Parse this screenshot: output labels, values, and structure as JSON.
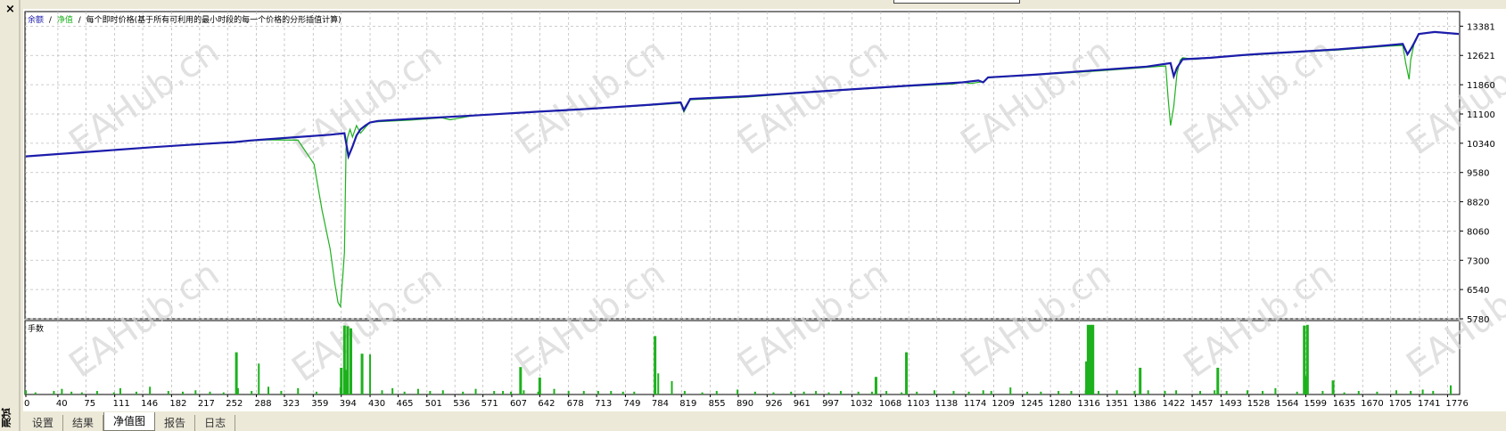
{
  "window": {
    "side_label": "测试",
    "close_glyph": "×"
  },
  "tabs": [
    {
      "label": "设置",
      "active": false
    },
    {
      "label": "结果",
      "active": false
    },
    {
      "label": "净值图",
      "active": true
    },
    {
      "label": "报告",
      "active": false
    },
    {
      "label": "日志",
      "active": false
    }
  ],
  "colors": {
    "balance": "#1c1cab",
    "equity": "#1db11d",
    "lots": "#1db11d",
    "grid": "#bdbdbd",
    "background": "#ffffff",
    "watermark": "#d4d4d4"
  },
  "watermark": "EAHub.cn",
  "chart_data": [
    {
      "type": "line",
      "legend": {
        "balance": "余额",
        "separator": "/",
        "equity": "净值",
        "description": "每个即时价格(基于所有可利用的最小时段的每一个价格的分形插值计算)"
      },
      "x_ticks": [
        0,
        40,
        75,
        111,
        146,
        182,
        217,
        252,
        288,
        323,
        359,
        394,
        430,
        465,
        501,
        536,
        571,
        607,
        642,
        678,
        713,
        749,
        784,
        819,
        855,
        890,
        926,
        961,
        997,
        1032,
        1068,
        1103,
        1138,
        1174,
        1209,
        1245,
        1280,
        1316,
        1351,
        1386,
        1422,
        1457,
        1493,
        1528,
        1564,
        1599,
        1635,
        1670,
        1705,
        1741,
        1776
      ],
      "y_ticks": [
        5780,
        6540,
        7300,
        8060,
        8820,
        9580,
        10340,
        11100,
        11860,
        12621,
        13381
      ],
      "ylim": [
        5780,
        13760
      ],
      "xlim": [
        0,
        1790
      ],
      "grid": true,
      "series": [
        {
          "name": "余额",
          "x": [
            0,
            40,
            100,
            160,
            220,
            260,
            280,
            300,
            340,
            380,
            398,
            403,
            408,
            413,
            418,
            424,
            430,
            440,
            480,
            560,
            640,
            700,
            780,
            818,
            822,
            830,
            900,
            1000,
            1100,
            1170,
            1190,
            1196,
            1202,
            1260,
            1340,
            1400,
            1430,
            1434,
            1438,
            1445,
            1480,
            1520,
            1540,
            1600,
            1640,
            1700,
            1720,
            1726,
            1730,
            1735,
            1740,
            1760,
            1790
          ],
          "y": [
            10000,
            10060,
            10150,
            10240,
            10320,
            10370,
            10410,
            10440,
            10500,
            10560,
            10600,
            10000,
            10250,
            10540,
            10700,
            10800,
            10880,
            10920,
            10970,
            11060,
            11160,
            11230,
            11340,
            11400,
            11200,
            11490,
            11560,
            11700,
            11830,
            11920,
            11970,
            11920,
            12050,
            12120,
            12240,
            12330,
            12420,
            12080,
            12300,
            12520,
            12560,
            12630,
            12660,
            12730,
            12780,
            12880,
            12920,
            12650,
            12780,
            12970,
            13180,
            13230,
            13180
          ]
        },
        {
          "name": "净值",
          "x": [
            0,
            40,
            100,
            160,
            220,
            260,
            280,
            300,
            340,
            360,
            370,
            380,
            386,
            390,
            393,
            396,
            398,
            400,
            402,
            405,
            408,
            413,
            418,
            424,
            430,
            440,
            480,
            520,
            530,
            560,
            640,
            700,
            780,
            818,
            822,
            830,
            900,
            1000,
            1100,
            1160,
            1170,
            1180,
            1196,
            1202,
            1260,
            1340,
            1400,
            1424,
            1427,
            1430,
            1434,
            1438,
            1442,
            1445,
            1460,
            1480,
            1520,
            1600,
            1640,
            1700,
            1720,
            1724,
            1728,
            1730,
            1735,
            1740,
            1760,
            1790
          ],
          "y": [
            10000,
            10060,
            10150,
            10240,
            10310,
            10360,
            10400,
            10430,
            10420,
            9800,
            8600,
            7600,
            6700,
            6200,
            6100,
            6900,
            7500,
            10200,
            10500,
            10700,
            10500,
            10800,
            10600,
            10750,
            10880,
            10900,
            10940,
            11000,
            10950,
            11060,
            11150,
            11220,
            11330,
            11380,
            11150,
            11470,
            11540,
            11690,
            11820,
            11880,
            11930,
            11890,
            11940,
            12040,
            12110,
            12220,
            12310,
            12350,
            11500,
            10800,
            11300,
            12150,
            12500,
            12560,
            12520,
            12560,
            12620,
            12720,
            12760,
            12860,
            12880,
            12400,
            12000,
            12500,
            13000,
            13180,
            13220,
            13170
          ]
        }
      ]
    },
    {
      "type": "bar",
      "title": "手数",
      "series_name": "手数",
      "ylim": [
        0,
        1
      ],
      "x": [
        0,
        12,
        35,
        45,
        57,
        70,
        89,
        110,
        118,
        138,
        155,
        178,
        196,
        212,
        230,
        247,
        265,
        282,
        291,
        303,
        319,
        340,
        363,
        393,
        400,
        430,
        445,
        458,
        473,
        490,
        505,
        521,
        546,
        562,
        585,
        596,
        606,
        622,
        640,
        660,
        678,
        697,
        715,
        731,
        746,
        760,
        790,
        807,
        823,
        845,
        863,
        889,
        911,
        934,
        956,
        972,
        987,
        1003,
        1018,
        1040,
        1057,
        1075,
        1094,
        1113,
        1135,
        1159,
        1178,
        1196,
        1206,
        1230,
        1251,
        1268,
        1290,
        1306,
        1324,
        1340,
        1363,
        1385,
        1402,
        1423,
        1437,
        1467,
        1485,
        1500,
        1526,
        1545,
        1561,
        1588,
        1620,
        1647,
        1665,
        1688,
        1712,
        1730,
        1745,
        1758,
        1780
      ],
      "values": [
        0.06,
        0.03,
        0.05,
        0.08,
        0.04,
        0.03,
        0.05,
        0.03,
        0.09,
        0.04,
        0.11,
        0.05,
        0.04,
        0.06,
        0.04,
        0.03,
        0.09,
        0.05,
        0.44,
        0.11,
        0.05,
        0.09,
        0.04,
        0.1,
        0.35,
        0.57,
        0.06,
        0.09,
        0.04,
        0.08,
        0.05,
        0.06,
        0.04,
        0.08,
        0.05,
        0.05,
        0.04,
        0.06,
        0.04,
        0.08,
        0.05,
        0.05,
        0.05,
        0.05,
        0.04,
        0.04,
        0.3,
        0.19,
        0.05,
        0.03,
        0.05,
        0.07,
        0.04,
        0.03,
        0.04,
        0.04,
        0.05,
        0.03,
        0.05,
        0.04,
        0.04,
        0.05,
        0.03,
        0.04,
        0.06,
        0.05,
        0.04,
        0.06,
        0.05,
        0.1,
        0.04,
        0.04,
        0.05,
        0.05,
        0.06,
        0.05,
        0.06,
        0.05,
        0.06,
        0.05,
        0.06,
        0.05,
        0.06,
        0.05,
        0.06,
        0.05,
        0.09,
        0.04,
        0.05,
        0.03,
        0.05,
        0.04,
        0.06,
        0.05,
        0.07,
        0.05,
        0.13
      ],
      "spikes": [
        {
          "x": 263,
          "value": 0.6
        },
        {
          "x": 394,
          "value": 0.38
        },
        {
          "x": 398,
          "value": 0.98
        },
        {
          "x": 402,
          "value": 0.97
        },
        {
          "x": 406,
          "value": 0.94
        },
        {
          "x": 420,
          "value": 0.58
        },
        {
          "x": 618,
          "value": 0.39
        },
        {
          "x": 642,
          "value": 0.24
        },
        {
          "x": 786,
          "value": 0.83
        },
        {
          "x": 1062,
          "value": 0.25
        },
        {
          "x": 1100,
          "value": 0.6
        },
        {
          "x": 1325,
          "value": 0.47
        },
        {
          "x": 1327,
          "value": 0.99
        },
        {
          "x": 1330,
          "value": 0.99
        },
        {
          "x": 1333,
          "value": 0.99
        },
        {
          "x": 1392,
          "value": 0.38
        },
        {
          "x": 1489,
          "value": 0.38
        },
        {
          "x": 1600,
          "value": 0.26
        },
        {
          "x": 1597,
          "value": 0.98
        },
        {
          "x": 1601,
          "value": 0.99
        },
        {
          "x": 1633,
          "value": 0.2
        }
      ]
    }
  ]
}
